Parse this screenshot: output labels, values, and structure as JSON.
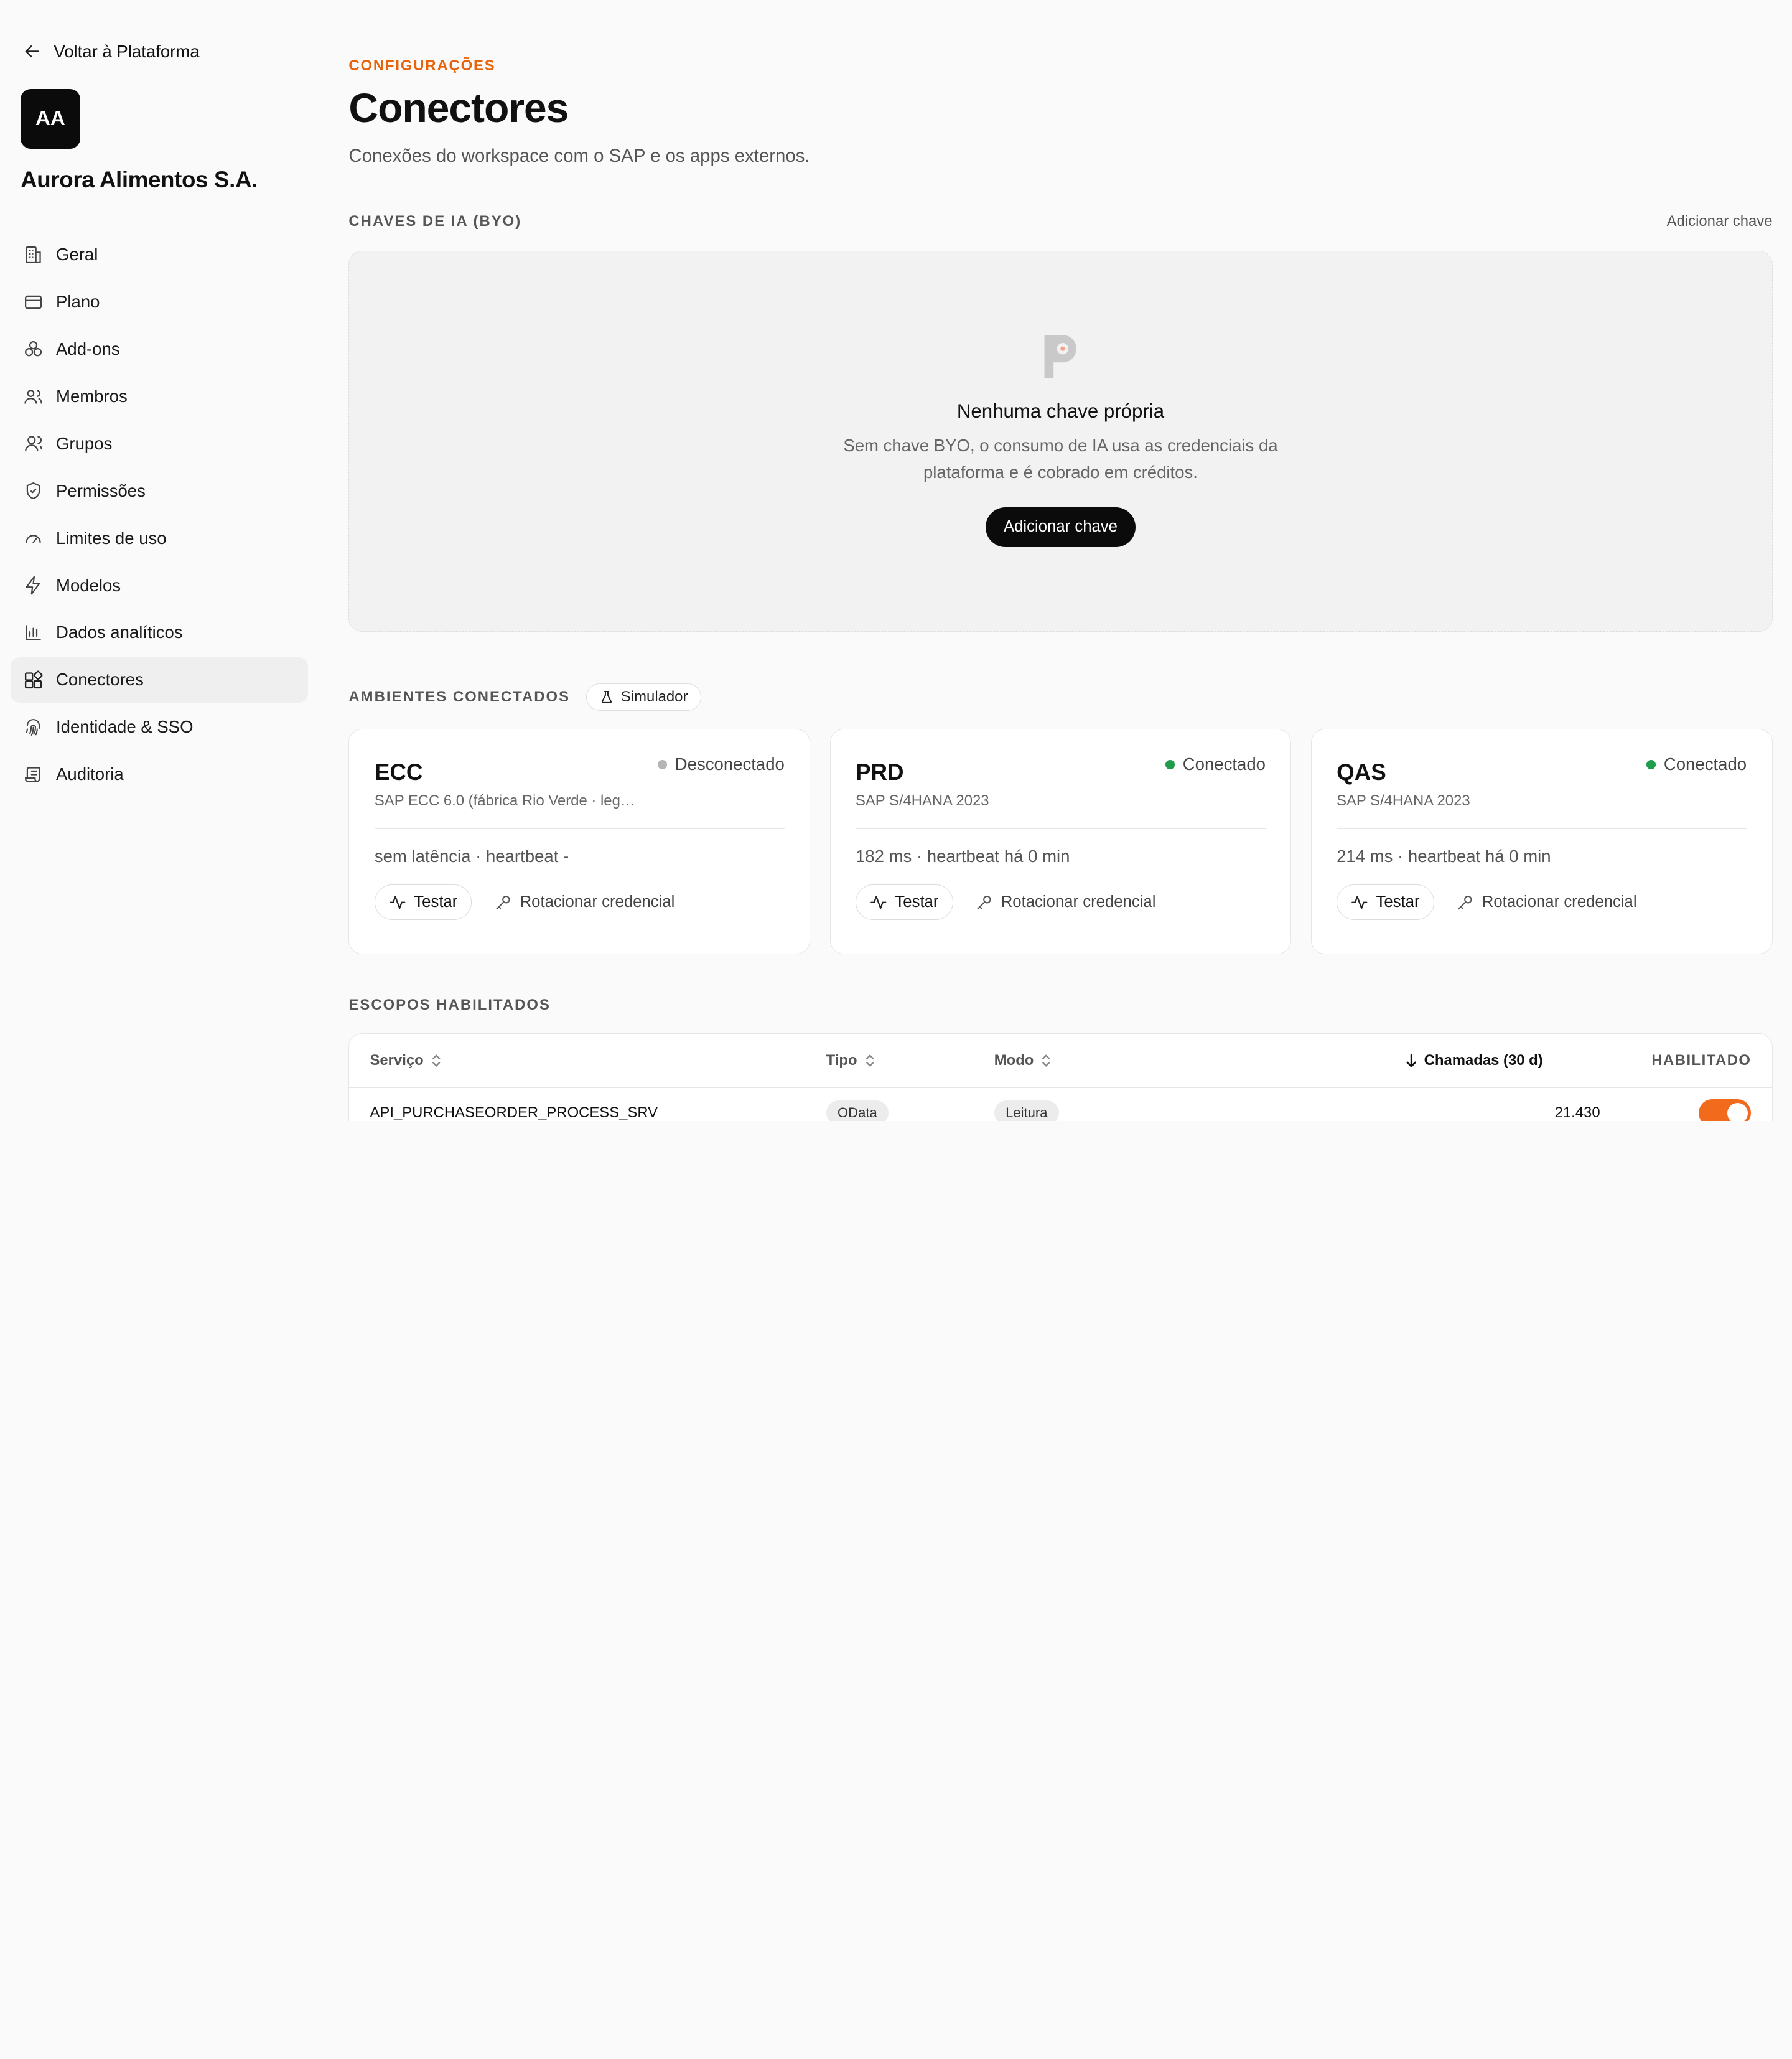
{
  "sidebar": {
    "back_label": "Voltar à Plataforma",
    "workspace_initials": "AA",
    "workspace_name": "Aurora Alimentos S.A.",
    "items": [
      {
        "label": "Geral",
        "icon": "building-icon"
      },
      {
        "label": "Plano",
        "icon": "credit-card-icon"
      },
      {
        "label": "Add-ons",
        "icon": "boxes-icon"
      },
      {
        "label": "Membros",
        "icon": "users-icon"
      },
      {
        "label": "Grupos",
        "icon": "user-group-icon"
      },
      {
        "label": "Permissões",
        "icon": "shield-icon"
      },
      {
        "label": "Limites de uso",
        "icon": "gauge-icon"
      },
      {
        "label": "Modelos",
        "icon": "bolt-icon"
      },
      {
        "label": "Dados analíticos",
        "icon": "bar-chart-icon"
      },
      {
        "label": "Conectores",
        "icon": "plug-grid-icon",
        "active": true
      },
      {
        "label": "Identidade & SSO",
        "icon": "fingerprint-icon"
      },
      {
        "label": "Auditoria",
        "icon": "scroll-icon"
      }
    ]
  },
  "header": {
    "eyebrow": "CONFIGURAÇÕES",
    "title": "Conectores",
    "subtitle": "Conexões do workspace com o SAP e os apps externos."
  },
  "byo": {
    "section_label": "CHAVES DE IA (BYO)",
    "add_link": "Adicionar chave",
    "empty_title": "Nenhuma chave própria",
    "empty_desc": "Sem chave BYO, o consumo de IA usa as credenciais da plataforma e é cobrado em créditos.",
    "add_button": "Adicionar chave"
  },
  "environments": {
    "section_label": "AMBIENTES CONECTADOS",
    "simulator_label": "Simulador",
    "test_label": "Testar",
    "rotate_label": "Rotacionar credencial",
    "cards": [
      {
        "name": "ECC",
        "status": "Desconectado",
        "status_color": "#b5b5b5",
        "desc": "SAP ECC 6.0 (fábrica Rio Verde · lega...",
        "metric": "sem latência · heartbeat -"
      },
      {
        "name": "PRD",
        "status": "Conectado",
        "status_color": "#1f9d4a",
        "desc": "SAP S/4HANA 2023",
        "metric": "182 ms · heartbeat há 0 min"
      },
      {
        "name": "QAS",
        "status": "Conectado",
        "status_color": "#1f9d4a",
        "desc": "SAP S/4HANA 2023",
        "metric": "214 ms · heartbeat há 0 min"
      }
    ]
  },
  "scopes": {
    "section_label": "ESCOPOS HABILITADOS",
    "columns": {
      "service": "Serviço",
      "type": "Tipo",
      "mode": "Modo",
      "calls": "Chamadas (30 d)",
      "enabled": "HABILITADO"
    },
    "rows": [
      {
        "service": "API_PURCHASEORDER_PROCESS_SRV",
        "type": "OData",
        "mode": "Leitura",
        "calls": "21.430",
        "enabled": true
      }
    ]
  },
  "colors": {
    "accent": "#e8630a",
    "toggle_on": "#f26a1b",
    "connected": "#1f9d4a",
    "disconnected": "#b5b5b5"
  }
}
